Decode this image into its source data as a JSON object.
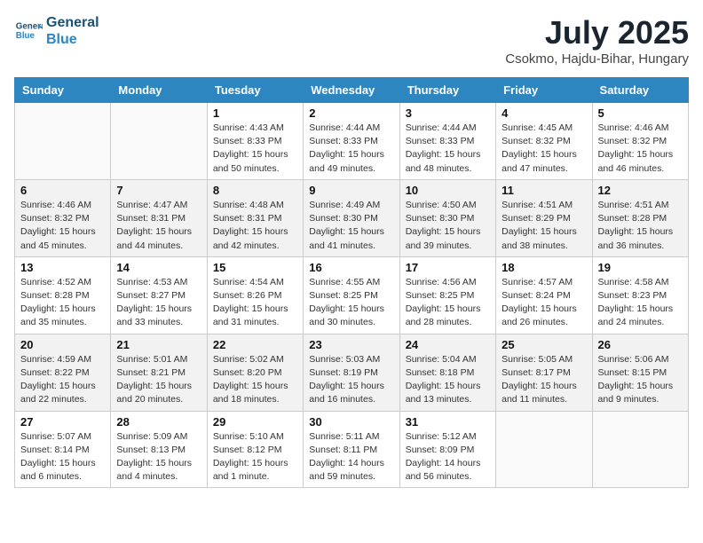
{
  "header": {
    "logo_line1": "General",
    "logo_line2": "Blue",
    "month_title": "July 2025",
    "location": "Csokmo, Hajdu-Bihar, Hungary"
  },
  "days_of_week": [
    "Sunday",
    "Monday",
    "Tuesday",
    "Wednesday",
    "Thursday",
    "Friday",
    "Saturday"
  ],
  "weeks": [
    [
      {
        "day": "",
        "info": ""
      },
      {
        "day": "",
        "info": ""
      },
      {
        "day": "1",
        "info": "Sunrise: 4:43 AM\nSunset: 8:33 PM\nDaylight: 15 hours and 50 minutes."
      },
      {
        "day": "2",
        "info": "Sunrise: 4:44 AM\nSunset: 8:33 PM\nDaylight: 15 hours and 49 minutes."
      },
      {
        "day": "3",
        "info": "Sunrise: 4:44 AM\nSunset: 8:33 PM\nDaylight: 15 hours and 48 minutes."
      },
      {
        "day": "4",
        "info": "Sunrise: 4:45 AM\nSunset: 8:32 PM\nDaylight: 15 hours and 47 minutes."
      },
      {
        "day": "5",
        "info": "Sunrise: 4:46 AM\nSunset: 8:32 PM\nDaylight: 15 hours and 46 minutes."
      }
    ],
    [
      {
        "day": "6",
        "info": "Sunrise: 4:46 AM\nSunset: 8:32 PM\nDaylight: 15 hours and 45 minutes."
      },
      {
        "day": "7",
        "info": "Sunrise: 4:47 AM\nSunset: 8:31 PM\nDaylight: 15 hours and 44 minutes."
      },
      {
        "day": "8",
        "info": "Sunrise: 4:48 AM\nSunset: 8:31 PM\nDaylight: 15 hours and 42 minutes."
      },
      {
        "day": "9",
        "info": "Sunrise: 4:49 AM\nSunset: 8:30 PM\nDaylight: 15 hours and 41 minutes."
      },
      {
        "day": "10",
        "info": "Sunrise: 4:50 AM\nSunset: 8:30 PM\nDaylight: 15 hours and 39 minutes."
      },
      {
        "day": "11",
        "info": "Sunrise: 4:51 AM\nSunset: 8:29 PM\nDaylight: 15 hours and 38 minutes."
      },
      {
        "day": "12",
        "info": "Sunrise: 4:51 AM\nSunset: 8:28 PM\nDaylight: 15 hours and 36 minutes."
      }
    ],
    [
      {
        "day": "13",
        "info": "Sunrise: 4:52 AM\nSunset: 8:28 PM\nDaylight: 15 hours and 35 minutes."
      },
      {
        "day": "14",
        "info": "Sunrise: 4:53 AM\nSunset: 8:27 PM\nDaylight: 15 hours and 33 minutes."
      },
      {
        "day": "15",
        "info": "Sunrise: 4:54 AM\nSunset: 8:26 PM\nDaylight: 15 hours and 31 minutes."
      },
      {
        "day": "16",
        "info": "Sunrise: 4:55 AM\nSunset: 8:25 PM\nDaylight: 15 hours and 30 minutes."
      },
      {
        "day": "17",
        "info": "Sunrise: 4:56 AM\nSunset: 8:25 PM\nDaylight: 15 hours and 28 minutes."
      },
      {
        "day": "18",
        "info": "Sunrise: 4:57 AM\nSunset: 8:24 PM\nDaylight: 15 hours and 26 minutes."
      },
      {
        "day": "19",
        "info": "Sunrise: 4:58 AM\nSunset: 8:23 PM\nDaylight: 15 hours and 24 minutes."
      }
    ],
    [
      {
        "day": "20",
        "info": "Sunrise: 4:59 AM\nSunset: 8:22 PM\nDaylight: 15 hours and 22 minutes."
      },
      {
        "day": "21",
        "info": "Sunrise: 5:01 AM\nSunset: 8:21 PM\nDaylight: 15 hours and 20 minutes."
      },
      {
        "day": "22",
        "info": "Sunrise: 5:02 AM\nSunset: 8:20 PM\nDaylight: 15 hours and 18 minutes."
      },
      {
        "day": "23",
        "info": "Sunrise: 5:03 AM\nSunset: 8:19 PM\nDaylight: 15 hours and 16 minutes."
      },
      {
        "day": "24",
        "info": "Sunrise: 5:04 AM\nSunset: 8:18 PM\nDaylight: 15 hours and 13 minutes."
      },
      {
        "day": "25",
        "info": "Sunrise: 5:05 AM\nSunset: 8:17 PM\nDaylight: 15 hours and 11 minutes."
      },
      {
        "day": "26",
        "info": "Sunrise: 5:06 AM\nSunset: 8:15 PM\nDaylight: 15 hours and 9 minutes."
      }
    ],
    [
      {
        "day": "27",
        "info": "Sunrise: 5:07 AM\nSunset: 8:14 PM\nDaylight: 15 hours and 6 minutes."
      },
      {
        "day": "28",
        "info": "Sunrise: 5:09 AM\nSunset: 8:13 PM\nDaylight: 15 hours and 4 minutes."
      },
      {
        "day": "29",
        "info": "Sunrise: 5:10 AM\nSunset: 8:12 PM\nDaylight: 15 hours and 1 minute."
      },
      {
        "day": "30",
        "info": "Sunrise: 5:11 AM\nSunset: 8:11 PM\nDaylight: 14 hours and 59 minutes."
      },
      {
        "day": "31",
        "info": "Sunrise: 5:12 AM\nSunset: 8:09 PM\nDaylight: 14 hours and 56 minutes."
      },
      {
        "day": "",
        "info": ""
      },
      {
        "day": "",
        "info": ""
      }
    ]
  ]
}
